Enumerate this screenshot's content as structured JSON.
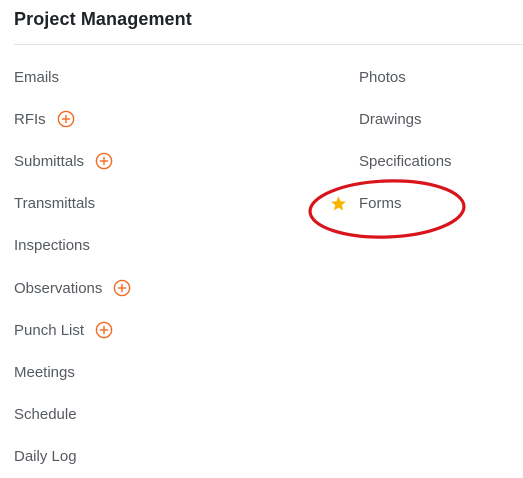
{
  "section": {
    "title": "Project Management"
  },
  "left_column": [
    {
      "label": "Emails",
      "has_add": false
    },
    {
      "label": "RFIs",
      "has_add": true
    },
    {
      "label": "Submittals",
      "has_add": true
    },
    {
      "label": "Transmittals",
      "has_add": false
    },
    {
      "label": "Inspections",
      "has_add": false
    },
    {
      "label": "Observations",
      "has_add": true
    },
    {
      "label": "Punch List",
      "has_add": true
    },
    {
      "label": "Meetings",
      "has_add": false
    },
    {
      "label": "Schedule",
      "has_add": false
    },
    {
      "label": "Daily Log",
      "has_add": false
    }
  ],
  "right_column": [
    {
      "label": "Photos",
      "starred": false
    },
    {
      "label": "Drawings",
      "starred": false
    },
    {
      "label": "Specifications",
      "starred": false
    },
    {
      "label": "Forms",
      "starred": true
    }
  ],
  "icons": {
    "add": "plus-circle-icon",
    "favorite": "star-icon"
  },
  "colors": {
    "accent_orange": "#f26a21",
    "star_yellow": "#f7b500",
    "annotation_red": "#d9141b",
    "text_gray": "#555a60",
    "title_dark": "#1f2327"
  }
}
